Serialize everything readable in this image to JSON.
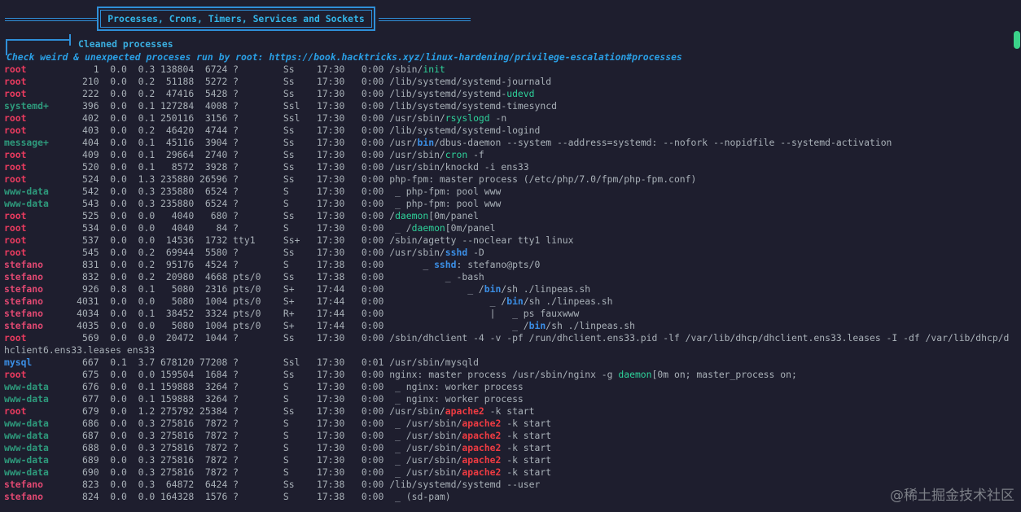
{
  "banner": {
    "title": "Processes, Crons, Timers, Services and Sockets"
  },
  "section": {
    "title": "Cleaned processes",
    "hint": "Check weird & unexpected proceses run by root: https://book.hacktricks.xyz/linux-hardening/privilege-escalation#processes"
  },
  "processes": [
    {
      "user": "root",
      "ucls": "u-root",
      "pid": "1",
      "cpu": "0.0",
      "mem": "0.3",
      "vsz": "138804",
      "rss": "6724",
      "tty": "?",
      "stat": "Ss",
      "start": "17:30",
      "time": "0:00",
      "cmd": [
        {
          "t": "/sbin/",
          "c": ""
        },
        {
          "t": "init",
          "c": "hl-green"
        }
      ]
    },
    {
      "user": "root",
      "ucls": "u-root",
      "pid": "210",
      "cpu": "0.0",
      "mem": "0.2",
      "vsz": "51188",
      "rss": "5272",
      "tty": "?",
      "stat": "Ss",
      "start": "17:30",
      "time": "0:00",
      "cmd": [
        {
          "t": "/lib/systemd/systemd-journald",
          "c": ""
        }
      ]
    },
    {
      "user": "root",
      "ucls": "u-root",
      "pid": "222",
      "cpu": "0.0",
      "mem": "0.2",
      "vsz": "47416",
      "rss": "5428",
      "tty": "?",
      "stat": "Ss",
      "start": "17:30",
      "time": "0:00",
      "cmd": [
        {
          "t": "/lib/systemd/systemd-",
          "c": ""
        },
        {
          "t": "udevd",
          "c": "hl-green"
        }
      ]
    },
    {
      "user": "systemd+",
      "ucls": "u-systemd",
      "pid": "396",
      "cpu": "0.0",
      "mem": "0.1",
      "vsz": "127284",
      "rss": "4008",
      "tty": "?",
      "stat": "Ssl",
      "start": "17:30",
      "time": "0:00",
      "cmd": [
        {
          "t": "/lib/systemd/systemd-timesyncd",
          "c": ""
        }
      ]
    },
    {
      "user": "root",
      "ucls": "u-root",
      "pid": "402",
      "cpu": "0.0",
      "mem": "0.1",
      "vsz": "250116",
      "rss": "3156",
      "tty": "?",
      "stat": "Ssl",
      "start": "17:30",
      "time": "0:00",
      "cmd": [
        {
          "t": "/usr/sbin/",
          "c": ""
        },
        {
          "t": "rsyslogd",
          "c": "hl-green"
        },
        {
          "t": " -n",
          "c": ""
        }
      ]
    },
    {
      "user": "root",
      "ucls": "u-root",
      "pid": "403",
      "cpu": "0.0",
      "mem": "0.2",
      "vsz": "46420",
      "rss": "4744",
      "tty": "?",
      "stat": "Ss",
      "start": "17:30",
      "time": "0:00",
      "cmd": [
        {
          "t": "/lib/systemd/systemd-logind",
          "c": ""
        }
      ]
    },
    {
      "user": "message+",
      "ucls": "u-message",
      "pid": "404",
      "cpu": "0.0",
      "mem": "0.1",
      "vsz": "45116",
      "rss": "3904",
      "tty": "?",
      "stat": "Ss",
      "start": "17:30",
      "time": "0:00",
      "cmd": [
        {
          "t": "/usr/",
          "c": ""
        },
        {
          "t": "bin",
          "c": "hl-blue"
        },
        {
          "t": "/dbus-daemon --system --address=systemd: --nofork --nopidfile --systemd-activation",
          "c": ""
        }
      ]
    },
    {
      "user": "root",
      "ucls": "u-root",
      "pid": "409",
      "cpu": "0.0",
      "mem": "0.1",
      "vsz": "29664",
      "rss": "2740",
      "tty": "?",
      "stat": "Ss",
      "start": "17:30",
      "time": "0:00",
      "cmd": [
        {
          "t": "/usr/sbin/",
          "c": ""
        },
        {
          "t": "cron",
          "c": "hl-green"
        },
        {
          "t": " -f",
          "c": ""
        }
      ]
    },
    {
      "user": "root",
      "ucls": "u-root",
      "pid": "520",
      "cpu": "0.0",
      "mem": "0.1",
      "vsz": "8572",
      "rss": "3928",
      "tty": "?",
      "stat": "Ss",
      "start": "17:30",
      "time": "0:00",
      "cmd": [
        {
          "t": "/usr/sbin/knockd -i ens33",
          "c": ""
        }
      ]
    },
    {
      "user": "root",
      "ucls": "u-root",
      "pid": "524",
      "cpu": "0.0",
      "mem": "1.3",
      "vsz": "235880",
      "rss": "26596",
      "tty": "?",
      "stat": "Ss",
      "start": "17:30",
      "time": "0:00",
      "cmd": [
        {
          "t": "php-fpm: master process (/etc/php/7.0/fpm/php-fpm.conf)",
          "c": ""
        }
      ]
    },
    {
      "user": "www-data",
      "ucls": "u-www",
      "pid": "542",
      "cpu": "0.0",
      "mem": "0.3",
      "vsz": "235880",
      "rss": "6524",
      "tty": "?",
      "stat": "S",
      "start": "17:30",
      "time": "0:00",
      "cmd": [
        {
          "t": " _ php-fpm: pool www",
          "c": ""
        }
      ]
    },
    {
      "user": "www-data",
      "ucls": "u-www",
      "pid": "543",
      "cpu": "0.0",
      "mem": "0.3",
      "vsz": "235880",
      "rss": "6524",
      "tty": "?",
      "stat": "S",
      "start": "17:30",
      "time": "0:00",
      "cmd": [
        {
          "t": " _ php-fpm: pool www",
          "c": ""
        }
      ]
    },
    {
      "user": "root",
      "ucls": "u-root",
      "pid": "525",
      "cpu": "0.0",
      "mem": "0.0",
      "vsz": "4040",
      "rss": "680",
      "tty": "?",
      "stat": "Ss",
      "start": "17:30",
      "time": "0:00",
      "cmd": [
        {
          "t": "/",
          "c": ""
        },
        {
          "t": "daemon",
          "c": "hl-green"
        },
        {
          "t": "[0m/panel",
          "c": ""
        }
      ]
    },
    {
      "user": "root",
      "ucls": "u-root",
      "pid": "534",
      "cpu": "0.0",
      "mem": "0.0",
      "vsz": "4040",
      "rss": "84",
      "tty": "?",
      "stat": "S",
      "start": "17:30",
      "time": "0:00",
      "cmd": [
        {
          "t": " _ /",
          "c": ""
        },
        {
          "t": "daemon",
          "c": "hl-green"
        },
        {
          "t": "[0m/panel",
          "c": ""
        }
      ]
    },
    {
      "user": "root",
      "ucls": "u-root",
      "pid": "537",
      "cpu": "0.0",
      "mem": "0.0",
      "vsz": "14536",
      "rss": "1732",
      "tty": "tty1",
      "stat": "Ss+",
      "start": "17:30",
      "time": "0:00",
      "cmd": [
        {
          "t": "/sbin/agetty --noclear tty1 linux",
          "c": ""
        }
      ]
    },
    {
      "user": "root",
      "ucls": "u-root",
      "pid": "545",
      "cpu": "0.0",
      "mem": "0.2",
      "vsz": "69944",
      "rss": "5580",
      "tty": "?",
      "stat": "Ss",
      "start": "17:30",
      "time": "0:00",
      "cmd": [
        {
          "t": "/usr/sbin/",
          "c": ""
        },
        {
          "t": "sshd",
          "c": "hl-blue"
        },
        {
          "t": " -D",
          "c": ""
        }
      ]
    },
    {
      "user": "stefano",
      "ucls": "u-stefano",
      "pid": "831",
      "cpu": "0.0",
      "mem": "0.2",
      "vsz": "95176",
      "rss": "4524",
      "tty": "?",
      "stat": "S",
      "start": "17:38",
      "time": "0:00",
      "cmd": [
        {
          "t": "      _ ",
          "c": ""
        },
        {
          "t": "sshd",
          "c": "hl-blue"
        },
        {
          "t": ": stefano@pts/0",
          "c": ""
        }
      ]
    },
    {
      "user": "stefano",
      "ucls": "u-stefano",
      "pid": "832",
      "cpu": "0.0",
      "mem": "0.2",
      "vsz": "20980",
      "rss": "4668",
      "tty": "pts/0",
      "stat": "Ss",
      "start": "17:38",
      "time": "0:00",
      "cmd": [
        {
          "t": "          _ -bash",
          "c": ""
        }
      ]
    },
    {
      "user": "stefano",
      "ucls": "u-stefano",
      "pid": "926",
      "cpu": "0.8",
      "mem": "0.1",
      "vsz": "5080",
      "rss": "2316",
      "tty": "pts/0",
      "stat": "S+",
      "start": "17:44",
      "time": "0:00",
      "cmd": [
        {
          "t": "              _ /",
          "c": ""
        },
        {
          "t": "bin",
          "c": "hl-blue"
        },
        {
          "t": "/sh ./linpeas.sh",
          "c": ""
        }
      ]
    },
    {
      "user": "stefano",
      "ucls": "u-stefano",
      "pid": "4031",
      "cpu": "0.0",
      "mem": "0.0",
      "vsz": "5080",
      "rss": "1004",
      "tty": "pts/0",
      "stat": "S+",
      "start": "17:44",
      "time": "0:00",
      "cmd": [
        {
          "t": "                  _ /",
          "c": ""
        },
        {
          "t": "bin",
          "c": "hl-blue"
        },
        {
          "t": "/sh ./linpeas.sh",
          "c": ""
        }
      ]
    },
    {
      "user": "stefano",
      "ucls": "u-stefano",
      "pid": "4034",
      "cpu": "0.0",
      "mem": "0.1",
      "vsz": "38452",
      "rss": "3324",
      "tty": "pts/0",
      "stat": "R+",
      "start": "17:44",
      "time": "0:00",
      "cmd": [
        {
          "t": "                  |   _ ps fauxwww",
          "c": ""
        }
      ]
    },
    {
      "user": "stefano",
      "ucls": "u-stefano",
      "pid": "4035",
      "cpu": "0.0",
      "mem": "0.0",
      "vsz": "5080",
      "rss": "1004",
      "tty": "pts/0",
      "stat": "S+",
      "start": "17:44",
      "time": "0:00",
      "cmd": [
        {
          "t": "                      _ /",
          "c": ""
        },
        {
          "t": "bin",
          "c": "hl-blue"
        },
        {
          "t": "/sh ./linpeas.sh",
          "c": ""
        }
      ]
    },
    {
      "user": "root",
      "ucls": "u-root",
      "pid": "569",
      "cpu": "0.0",
      "mem": "0.0",
      "vsz": "20472",
      "rss": "1044",
      "tty": "?",
      "stat": "Ss",
      "start": "17:30",
      "time": "0:00",
      "cmd": [
        {
          "t": "/sbin/dhclient -4 -v -pf /run/dhclient.ens33.pid -lf /var/lib/dhcp/dhclient.ens33.leases -I -df /var/lib/dhcp/d",
          "c": ""
        }
      ]
    },
    {
      "user": "",
      "ucls": "",
      "pid": "",
      "cpu": "",
      "mem": "",
      "vsz": "",
      "rss": "",
      "tty": "",
      "stat": "",
      "start": "",
      "time": "",
      "raw": "hclient6.ens33.leases ens33",
      "cmd": []
    },
    {
      "user": "mysql",
      "ucls": "u-mysql",
      "pid": "667",
      "cpu": "0.1",
      "mem": "3.7",
      "vsz": "678120",
      "rss": "77208",
      "tty": "?",
      "stat": "Ssl",
      "start": "17:30",
      "time": "0:01",
      "cmd": [
        {
          "t": "/usr/sbin/mysqld",
          "c": ""
        }
      ]
    },
    {
      "user": "root",
      "ucls": "u-root",
      "pid": "675",
      "cpu": "0.0",
      "mem": "0.0",
      "vsz": "159504",
      "rss": "1684",
      "tty": "?",
      "stat": "Ss",
      "start": "17:30",
      "time": "0:00",
      "cmd": [
        {
          "t": "nginx: master process /usr/sbin/nginx -g ",
          "c": ""
        },
        {
          "t": "daemon",
          "c": "hl-green"
        },
        {
          "t": "[0m on; master_process on;",
          "c": ""
        }
      ]
    },
    {
      "user": "www-data",
      "ucls": "u-www",
      "pid": "676",
      "cpu": "0.0",
      "mem": "0.1",
      "vsz": "159888",
      "rss": "3264",
      "tty": "?",
      "stat": "S",
      "start": "17:30",
      "time": "0:00",
      "cmd": [
        {
          "t": " _ nginx: worker process",
          "c": ""
        }
      ]
    },
    {
      "user": "www-data",
      "ucls": "u-www",
      "pid": "677",
      "cpu": "0.0",
      "mem": "0.1",
      "vsz": "159888",
      "rss": "3264",
      "tty": "?",
      "stat": "S",
      "start": "17:30",
      "time": "0:00",
      "cmd": [
        {
          "t": " _ nginx: worker process",
          "c": ""
        }
      ]
    },
    {
      "user": "root",
      "ucls": "u-root",
      "pid": "679",
      "cpu": "0.0",
      "mem": "1.2",
      "vsz": "275792",
      "rss": "25384",
      "tty": "?",
      "stat": "Ss",
      "start": "17:30",
      "time": "0:00",
      "cmd": [
        {
          "t": "/usr/sbin/",
          "c": ""
        },
        {
          "t": "apache2",
          "c": "hl-red"
        },
        {
          "t": " -k start",
          "c": ""
        }
      ]
    },
    {
      "user": "www-data",
      "ucls": "u-www",
      "pid": "686",
      "cpu": "0.0",
      "mem": "0.3",
      "vsz": "275816",
      "rss": "7872",
      "tty": "?",
      "stat": "S",
      "start": "17:30",
      "time": "0:00",
      "cmd": [
        {
          "t": " _ /usr/sbin/",
          "c": ""
        },
        {
          "t": "apache2",
          "c": "hl-red"
        },
        {
          "t": " -k start",
          "c": ""
        }
      ]
    },
    {
      "user": "www-data",
      "ucls": "u-www",
      "pid": "687",
      "cpu": "0.0",
      "mem": "0.3",
      "vsz": "275816",
      "rss": "7872",
      "tty": "?",
      "stat": "S",
      "start": "17:30",
      "time": "0:00",
      "cmd": [
        {
          "t": " _ /usr/sbin/",
          "c": ""
        },
        {
          "t": "apache2",
          "c": "hl-red"
        },
        {
          "t": " -k start",
          "c": ""
        }
      ]
    },
    {
      "user": "www-data",
      "ucls": "u-www",
      "pid": "688",
      "cpu": "0.0",
      "mem": "0.3",
      "vsz": "275816",
      "rss": "7872",
      "tty": "?",
      "stat": "S",
      "start": "17:30",
      "time": "0:00",
      "cmd": [
        {
          "t": " _ /usr/sbin/",
          "c": ""
        },
        {
          "t": "apache2",
          "c": "hl-red"
        },
        {
          "t": " -k start",
          "c": ""
        }
      ]
    },
    {
      "user": "www-data",
      "ucls": "u-www",
      "pid": "689",
      "cpu": "0.0",
      "mem": "0.3",
      "vsz": "275816",
      "rss": "7872",
      "tty": "?",
      "stat": "S",
      "start": "17:30",
      "time": "0:00",
      "cmd": [
        {
          "t": " _ /usr/sbin/",
          "c": ""
        },
        {
          "t": "apache2",
          "c": "hl-red"
        },
        {
          "t": " -k start",
          "c": ""
        }
      ]
    },
    {
      "user": "www-data",
      "ucls": "u-www",
      "pid": "690",
      "cpu": "0.0",
      "mem": "0.3",
      "vsz": "275816",
      "rss": "7872",
      "tty": "?",
      "stat": "S",
      "start": "17:30",
      "time": "0:00",
      "cmd": [
        {
          "t": " _ /usr/sbin/",
          "c": ""
        },
        {
          "t": "apache2",
          "c": "hl-red"
        },
        {
          "t": " -k start",
          "c": ""
        }
      ]
    },
    {
      "user": "stefano",
      "ucls": "u-stefano",
      "pid": "823",
      "cpu": "0.0",
      "mem": "0.3",
      "vsz": "64872",
      "rss": "6424",
      "tty": "?",
      "stat": "Ss",
      "start": "17:38",
      "time": "0:00",
      "cmd": [
        {
          "t": "/lib/systemd/systemd --user",
          "c": ""
        }
      ]
    },
    {
      "user": "stefano",
      "ucls": "u-stefano",
      "pid": "824",
      "cpu": "0.0",
      "mem": "0.0",
      "vsz": "164328",
      "rss": "1576",
      "tty": "?",
      "stat": "S",
      "start": "17:38",
      "time": "0:00",
      "cmd": [
        {
          "t": " _ (sd-pam)",
          "c": ""
        }
      ]
    }
  ],
  "watermark": "@稀土掘金技术社区",
  "colors": {
    "background": "#1e1e2e",
    "accent": "#2f8fd8",
    "root": "#ea3b5f",
    "www-data": "#2e9a7c",
    "highlight-red": "#ee3b42",
    "scrollbar": "#3bd38a"
  }
}
